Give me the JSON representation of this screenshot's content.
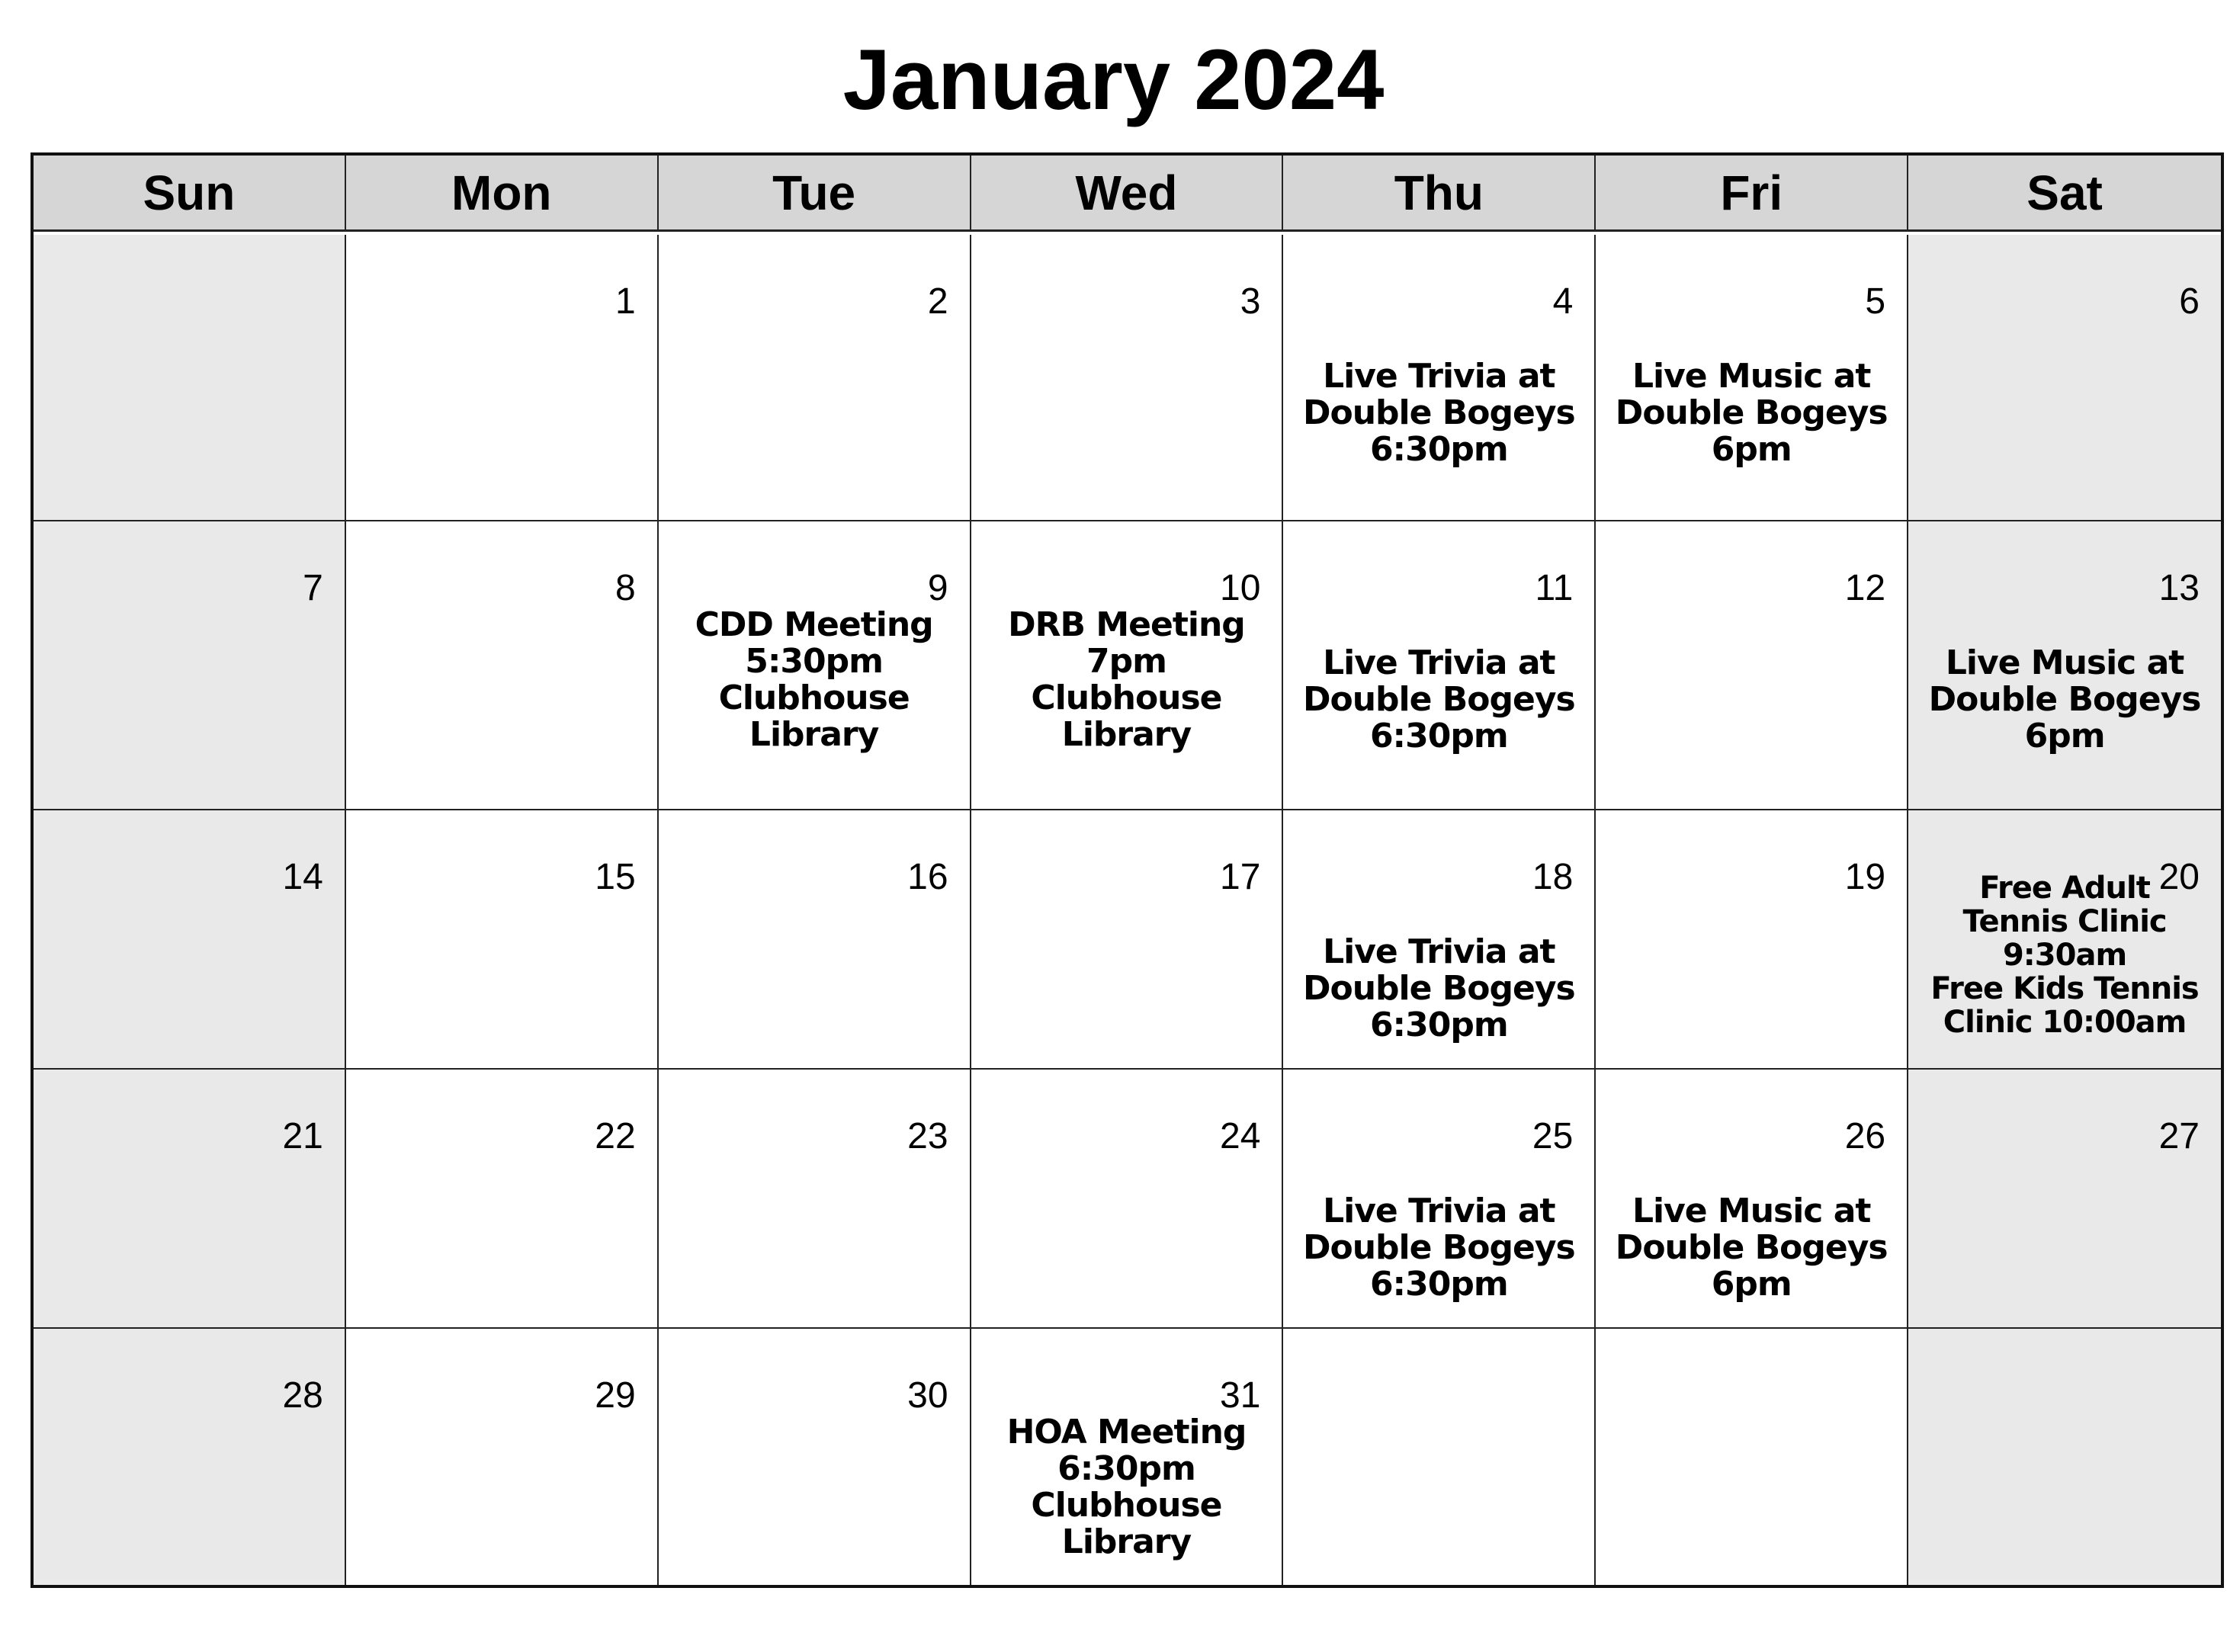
{
  "title": "January 2024",
  "weekdays": [
    "Sun",
    "Mon",
    "Tue",
    "Wed",
    "Thu",
    "Fri",
    "Sat"
  ],
  "weeks": [
    [
      {
        "day": "",
        "event": ""
      },
      {
        "day": "1",
        "event": ""
      },
      {
        "day": "2",
        "event": ""
      },
      {
        "day": "3",
        "event": ""
      },
      {
        "day": "4",
        "event": "Live Trivia at\nDouble Bogeys\n6:30pm"
      },
      {
        "day": "5",
        "event": "Live Music at\nDouble Bogeys\n6pm"
      },
      {
        "day": "6",
        "event": ""
      }
    ],
    [
      {
        "day": "7",
        "event": ""
      },
      {
        "day": "8",
        "event": ""
      },
      {
        "day": "9",
        "event": "CDD Meeting\n5:30pm\nClubhouse\nLibrary"
      },
      {
        "day": "10",
        "event": "DRB Meeting\n7pm\nClubhouse\nLibrary"
      },
      {
        "day": "11",
        "event": "Live Trivia at\nDouble Bogeys\n6:30pm"
      },
      {
        "day": "12",
        "event": ""
      },
      {
        "day": "13",
        "event": "Live Music at\nDouble Bogeys\n6pm"
      }
    ],
    [
      {
        "day": "14",
        "event": ""
      },
      {
        "day": "15",
        "event": ""
      },
      {
        "day": "16",
        "event": ""
      },
      {
        "day": "17",
        "event": ""
      },
      {
        "day": "18",
        "event": "Live Trivia at\nDouble Bogeys\n6:30pm"
      },
      {
        "day": "19",
        "event": ""
      },
      {
        "day": "20",
        "event": "Free Adult\nTennis Clinic\n9:30am\nFree Kids Tennis\nClinic 10:00am"
      }
    ],
    [
      {
        "day": "21",
        "event": ""
      },
      {
        "day": "22",
        "event": ""
      },
      {
        "day": "23",
        "event": ""
      },
      {
        "day": "24",
        "event": ""
      },
      {
        "day": "25",
        "event": "Live Trivia at\nDouble Bogeys\n6:30pm"
      },
      {
        "day": "26",
        "event": "Live Music at\nDouble Bogeys\n6pm"
      },
      {
        "day": "27",
        "event": ""
      }
    ],
    [
      {
        "day": "28",
        "event": ""
      },
      {
        "day": "29",
        "event": ""
      },
      {
        "day": "30",
        "event": ""
      },
      {
        "day": "31",
        "event": "HOA Meeting\n6:30pm\nClubhouse\nLibrary"
      },
      {
        "day": "",
        "event": ""
      },
      {
        "day": "",
        "event": ""
      },
      {
        "day": "",
        "event": ""
      }
    ]
  ],
  "colors": {
    "header_bg": "#d6d6d6",
    "weekend_bg": "#e9e9e9",
    "weekday_bg": "#ffffff",
    "grid": "#222222"
  }
}
